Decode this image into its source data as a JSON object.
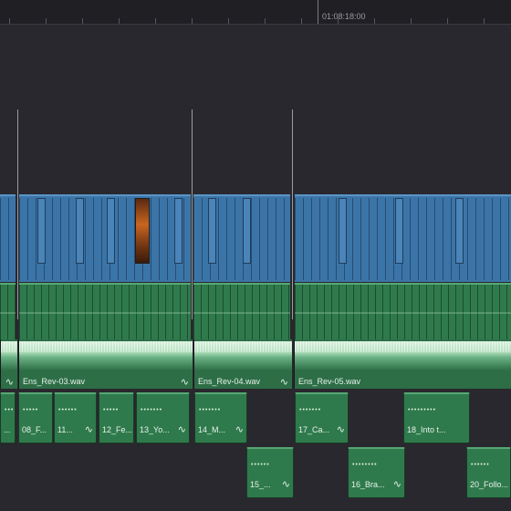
{
  "ruler": {
    "timecode": "01:08:18:00"
  },
  "audio_track": {
    "clips": [
      {
        "name": "Ens_Rev-03.wav"
      },
      {
        "name": "Ens_Rev-04.wav"
      },
      {
        "name": "Ens_Rev-05.wav"
      }
    ]
  },
  "sound_clips": {
    "row1": [
      {
        "label": "..."
      },
      {
        "label": "08_F..."
      },
      {
        "label": "11..."
      },
      {
        "label": "12_Fe..."
      },
      {
        "label": "13_Yo..."
      },
      {
        "label": "14_M..."
      },
      {
        "label": "17_Ca..."
      },
      {
        "label": "18_Into t..."
      }
    ],
    "row2": [
      {
        "label": "15_..."
      },
      {
        "label": "16_Bra..."
      },
      {
        "label": "20_Follo..."
      }
    ]
  },
  "icons": {
    "fade": "fade-curve-icon"
  },
  "colors": {
    "video": "#3b75a8",
    "audio": "#2f7a4c",
    "background": "#28282e"
  }
}
